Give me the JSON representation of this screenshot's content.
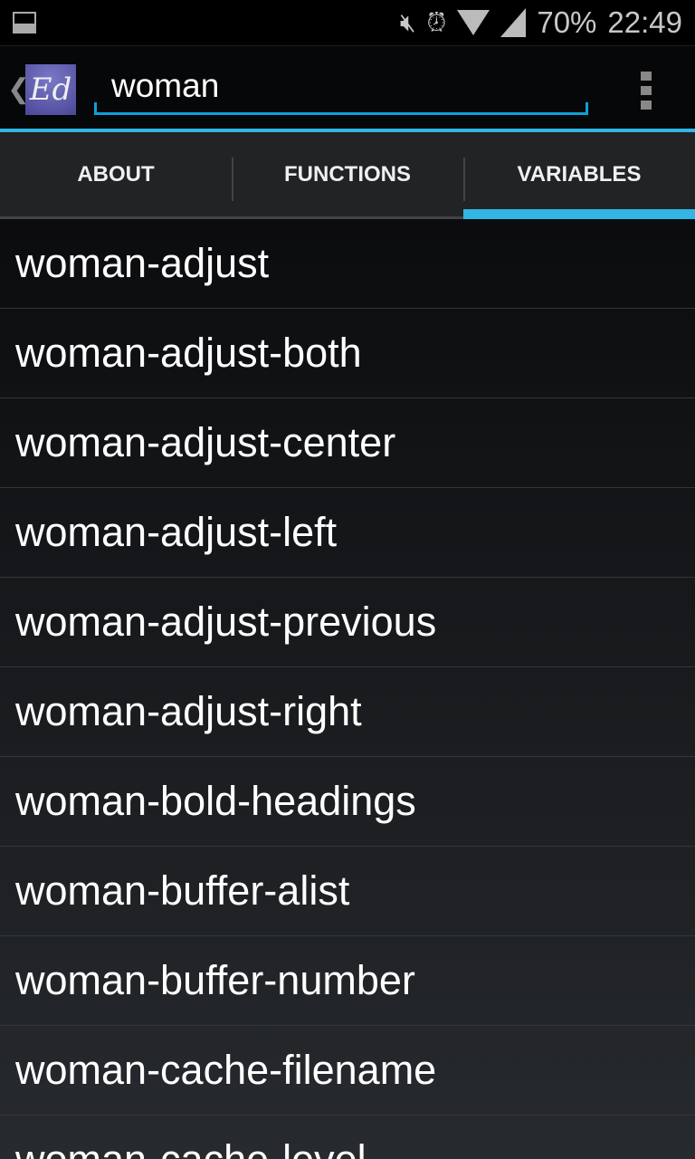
{
  "status_bar": {
    "notification_icon": "picture-icon",
    "battery": "70%",
    "time": "22:49",
    "icons": [
      "mute-icon",
      "alarm-icon",
      "wifi-icon",
      "signal-icon"
    ]
  },
  "action_bar": {
    "app_icon_text": "Ed",
    "search_value": "woman"
  },
  "tabs": [
    {
      "label": "ABOUT"
    },
    {
      "label": "FUNCTIONS"
    },
    {
      "label": "VARIABLES",
      "active": true
    }
  ],
  "items": [
    "woman-adjust",
    "woman-adjust-both",
    "woman-adjust-center",
    "woman-adjust-left",
    "woman-adjust-previous",
    "woman-adjust-right",
    "woman-bold-headings",
    "woman-buffer-alist",
    "woman-buffer-number",
    "woman-cache-filename",
    "woman-cache-level"
  ],
  "colors": {
    "accent": "#33b5e5"
  }
}
